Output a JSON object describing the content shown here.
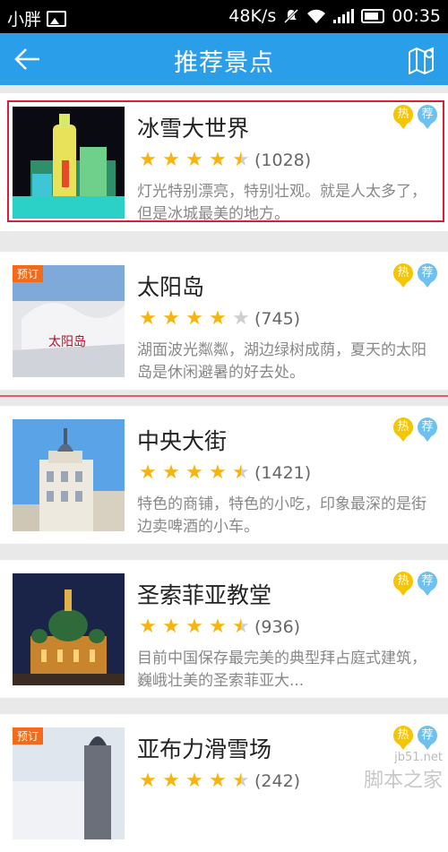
{
  "status_bar": {
    "carrier": "小胖",
    "speed": "48K/s",
    "time": "00:35"
  },
  "header": {
    "title": "推荐景点",
    "back_icon": "arrow-left-icon",
    "map_icon": "map-icon"
  },
  "tags": {
    "hot": "热",
    "recommend": "荐"
  },
  "attractions": [
    {
      "name": "冰雪大世界",
      "rating_count": "(1028)",
      "stars": 4.5,
      "description": "灯光特别漂亮，特别壮观。就是人太多了，但是冰城最美的地方。",
      "badge": ""
    },
    {
      "name": "太阳岛",
      "rating_count": "(745)",
      "stars": 4,
      "description": "湖面波光粼粼，湖边绿树成荫，夏天的太阳岛是休闲避暑的好去处。",
      "badge": "预订"
    },
    {
      "name": "中央大街",
      "rating_count": "(1421)",
      "stars": 4.5,
      "description": "特色的商铺，特色的小吃，印象最深的是街边卖啤酒的小车。",
      "badge": ""
    },
    {
      "name": "圣索菲亚教堂",
      "rating_count": "(936)",
      "stars": 4.5,
      "description": "目前中国保存最完美的典型拜占庭式建筑，巍峨壮美的圣索菲亚大...",
      "badge": ""
    },
    {
      "name": "亚布力滑雪场",
      "rating_count": "(242)",
      "stars": 4.5,
      "description": "",
      "badge": "预订"
    }
  ],
  "watermark": {
    "site": "jb51.net",
    "name": "脚本之家"
  }
}
